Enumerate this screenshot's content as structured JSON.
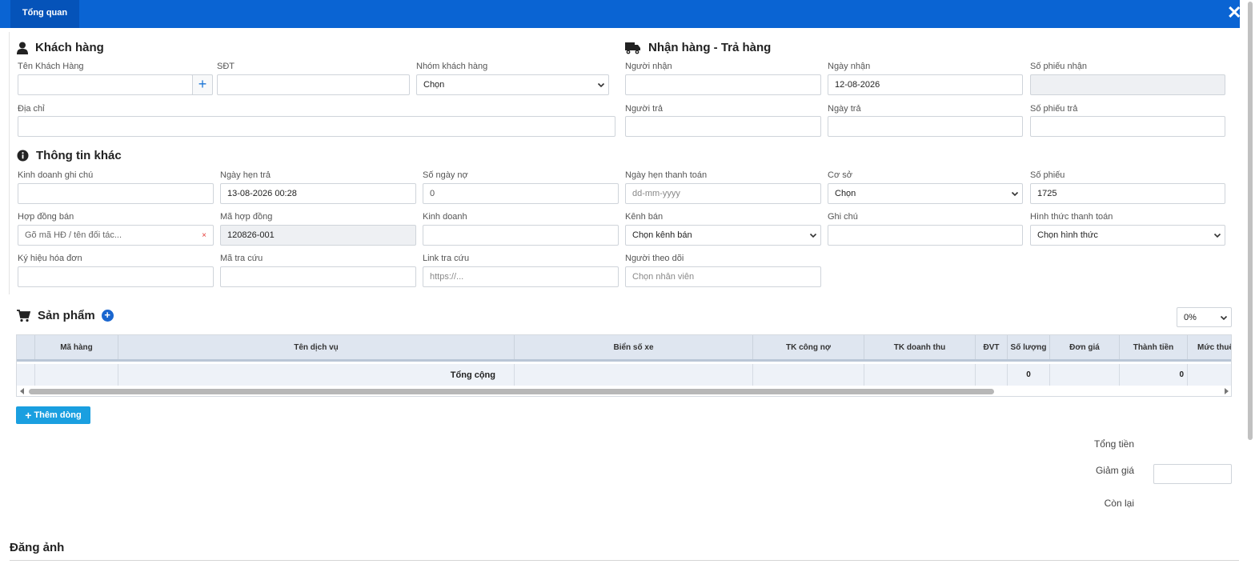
{
  "header": {
    "tab_label": "Tổng quan",
    "close_symbol": "✕"
  },
  "customer": {
    "title": "Khách hàng",
    "name_label": "Tên Khách Hàng",
    "name_value": "",
    "add_symbol": "+",
    "phone_label": "SĐT",
    "phone_value": "",
    "group_label": "Nhóm khách hàng",
    "group_selected": "Chọn",
    "address_label": "Địa chỉ",
    "address_value": ""
  },
  "delivery": {
    "title": "Nhận hàng - Trả hàng",
    "receiver_label": "Người nhận",
    "receiver_value": "",
    "receive_date_label": "Ngày nhận",
    "receive_date_value": "12-08-2026",
    "receive_slip_label": "Số phiếu nhận",
    "receive_slip_value": "",
    "returner_label": "Người trả",
    "returner_value": "",
    "return_date_label": "Ngày trả",
    "return_date_value": "",
    "return_slip_label": "Số phiếu trả",
    "return_slip_value": ""
  },
  "other": {
    "title": "Thông tin khác",
    "sales_note_label": "Kinh doanh ghi chú",
    "sales_note_value": "",
    "due_date_label": "Ngày hẹn trả",
    "due_date_value": "13-08-2026 00:28",
    "debt_days_label": "Số ngày nợ",
    "debt_days_value": "0",
    "pay_date_label": "Ngày hẹn thanh toán",
    "pay_date_placeholder": "dd-mm-yyyy",
    "branch_label": "Cơ sở",
    "branch_selected": "Chọn",
    "slip_no_label": "Số phiếu",
    "slip_no_value": "1725",
    "contract_label": "Hợp đồng bán",
    "contract_placeholder": "Gõ mã HĐ / tên đối tác...",
    "contract_clear": "×",
    "contract_code_label": "Mã hợp đồng",
    "contract_code_value": "120826-001",
    "sales_label": "Kinh doanh",
    "sales_value": "",
    "channel_label": "Kênh bán",
    "channel_selected": "Chọn kênh bán",
    "note_label": "Ghi chú",
    "note_value": "",
    "payment_label": "Hình thức thanh toán",
    "payment_selected": "Chọn hình thức",
    "invoice_symbol_label": "Ký hiệu hóa đơn",
    "invoice_symbol_value": "",
    "lookup_code_label": "Mã tra cứu",
    "lookup_code_value": "",
    "lookup_link_label": "Link tra cứu",
    "lookup_link_placeholder": "https://...",
    "follower_label": "Người theo dõi",
    "follower_placeholder": "Chọn nhân viên"
  },
  "products": {
    "title": "Sản phẩm",
    "add_symbol": "+",
    "vat_selected": "0%",
    "columns": [
      "",
      "Mã hàng",
      "Tên dịch vụ",
      "Biển số xe",
      "TK công nợ",
      "TK doanh thu",
      "ĐVT",
      "Số lượng",
      "Đơn giá",
      "Thành tiền",
      "Mức thuế"
    ],
    "footer": {
      "label": "Tổng cộng",
      "quantity": "0",
      "amount": "0"
    },
    "add_row_label": "Thêm dòng"
  },
  "summary": {
    "total_label": "Tổng tiền",
    "total_value": "",
    "discount_label": "Giảm giá",
    "discount_value": "",
    "remaining_label": "Còn lại",
    "remaining_value": ""
  },
  "upload": {
    "title": "Đăng ảnh"
  },
  "colors": {
    "header_bg": "#0a64d3",
    "tab_bg": "#0553b9",
    "accent": "#1a74d6",
    "add_row_button": "#1a9fe0",
    "clear_icon": "#e53935"
  }
}
